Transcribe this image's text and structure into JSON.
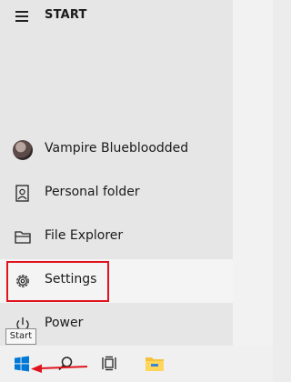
{
  "start_menu": {
    "title": "START",
    "items": [
      {
        "label": "Vampire Bluebloodded",
        "icon": "user-avatar-icon"
      },
      {
        "label": "Personal folder",
        "icon": "personal-folder-icon"
      },
      {
        "label": "File Explorer",
        "icon": "file-explorer-icon"
      },
      {
        "label": "Settings",
        "icon": "gear-icon"
      },
      {
        "label": "Power",
        "icon": "power-icon"
      }
    ]
  },
  "tooltip": {
    "text": "Start"
  },
  "taskbar": {
    "buttons": [
      {
        "name": "start",
        "icon": "windows-logo-icon"
      },
      {
        "name": "search",
        "icon": "search-icon"
      },
      {
        "name": "task-view",
        "icon": "task-view-icon"
      },
      {
        "name": "file-explorer",
        "icon": "folder-icon"
      }
    ]
  },
  "colors": {
    "highlight_box": "#e0141e",
    "accent_blue": "#0078d7",
    "folder_yellow": "#f4c23c"
  }
}
